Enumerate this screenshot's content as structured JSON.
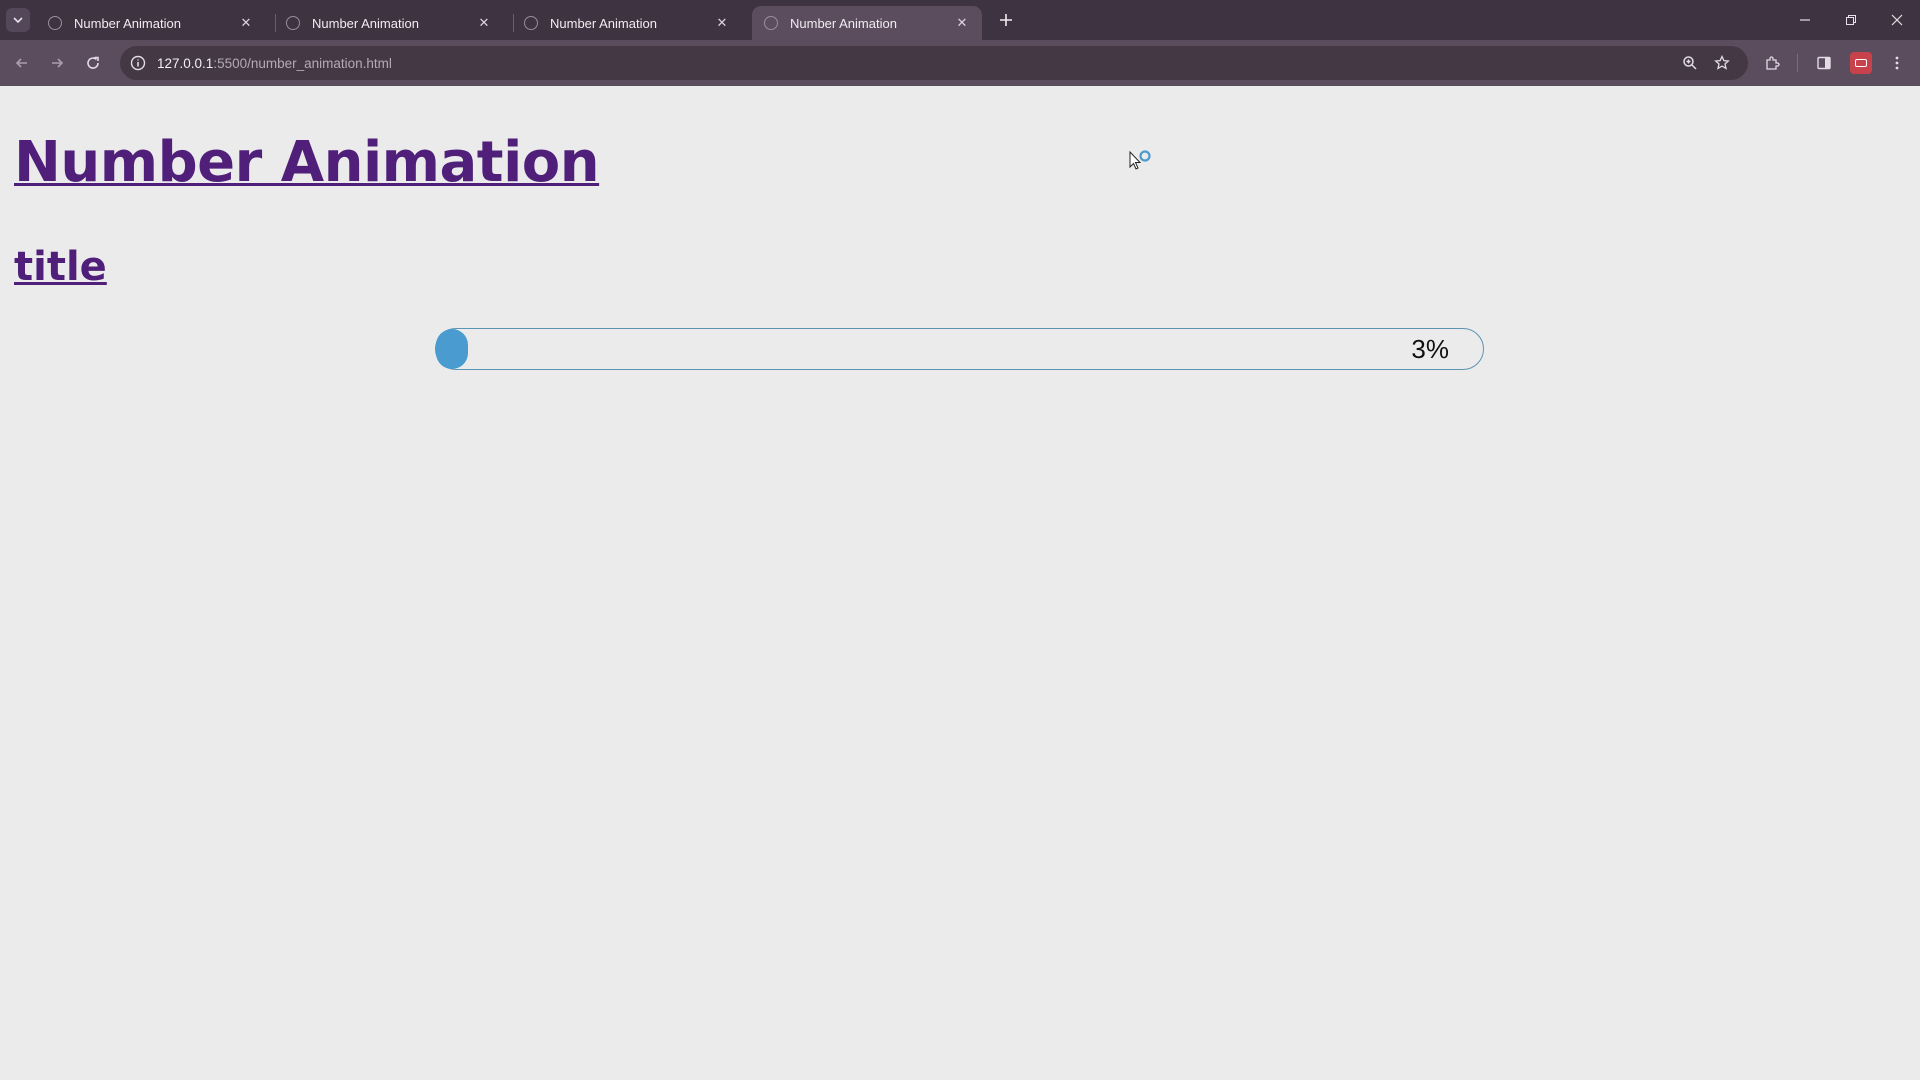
{
  "browser": {
    "tabs": [
      {
        "title": "Number Animation",
        "active": false
      },
      {
        "title": "Number Animation",
        "active": false
      },
      {
        "title": "Number Animation",
        "active": false
      },
      {
        "title": "Number Animation",
        "active": true
      }
    ],
    "url_host": "127.0.0.1",
    "url_rest": ":5500/number_animation.html"
  },
  "page": {
    "heading": "Number Animation",
    "subheading": "title",
    "progress": {
      "value_percent": 3,
      "label": "3%",
      "fill_color": "#4a9bd0",
      "border_color": "#5c94b3"
    }
  },
  "colors": {
    "heading": "#4f1f7a",
    "page_background": "#ebebeb",
    "chrome_frame": "#3e3340",
    "chrome_toolbar": "#5b4d5e"
  }
}
